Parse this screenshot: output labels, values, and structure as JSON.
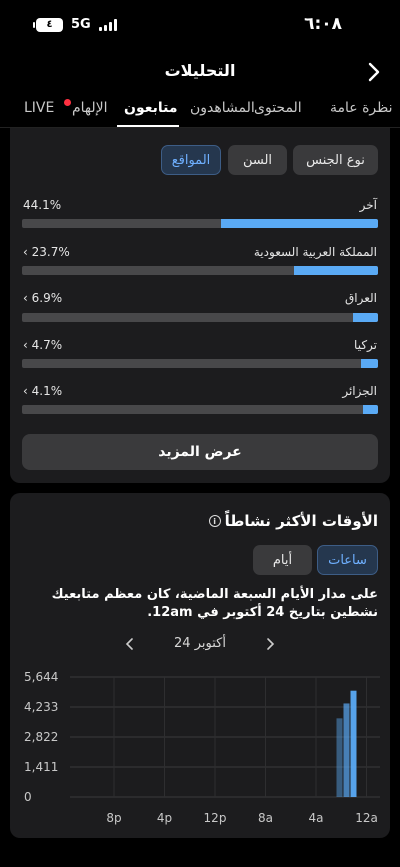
{
  "status_bar": {
    "time": "٦:٠٨",
    "battery": "٤",
    "network": "5G"
  },
  "header": {
    "title": "التحليلات",
    "back_icon": "chevron-right-icon"
  },
  "tabs": [
    {
      "label": "نظرة عامة",
      "active": false
    },
    {
      "label": "المحتوى",
      "active": false
    },
    {
      "label": "المشاهدون",
      "active": false
    },
    {
      "label": "متابعون",
      "active": true
    },
    {
      "label": "الإلهام",
      "active": false
    },
    {
      "label": "LIVE",
      "active": false
    }
  ],
  "filters": {
    "gender": "نوع الجنس",
    "age": "السن",
    "locations": "المواقع",
    "selected": "المواقع"
  },
  "locations": [
    {
      "name": "آخر",
      "percent": "44.1%",
      "value": 0.441,
      "expandable": false
    },
    {
      "name": "المملكة العربية السعودية",
      "percent": "23.7%",
      "value": 0.237,
      "expandable": true
    },
    {
      "name": "العراق",
      "percent": "6.9%",
      "value": 0.069,
      "expandable": true
    },
    {
      "name": "تركيا",
      "percent": "4.7%",
      "value": 0.047,
      "expandable": true
    },
    {
      "name": "الجزائر",
      "percent": "4.1%",
      "value": 0.041,
      "expandable": true
    }
  ],
  "show_more": "عرض المزيد",
  "active_times": {
    "title": "الأوقات الأكثر نشاطاً",
    "info_icon": "info-icon",
    "segments": {
      "hours": "ساعات",
      "days": "أيام",
      "selected": "ساعات"
    },
    "description": "على مدار الأيام السبعة الماضية، كان معظم متابعيك نشطين بتاريخ 24 أكتوبر في 12am.",
    "date_label": "24 أكتوبر"
  },
  "colors": {
    "accent": "#5aaaf5",
    "selected_chip_bg": "#25374e",
    "card_bg": "#1c1c1e"
  },
  "chart_data": {
    "type": "bar",
    "x_ticks": [
      "8p",
      "4p",
      "12p",
      "8a",
      "4a",
      "12a"
    ],
    "y_ticks": [
      "5,644",
      "4,233",
      "2,822",
      "1,411",
      "0"
    ],
    "ylim": [
      0,
      5644
    ],
    "grid": true,
    "series": [
      {
        "values": [
          3700,
          4400,
          5000
        ]
      }
    ]
  }
}
